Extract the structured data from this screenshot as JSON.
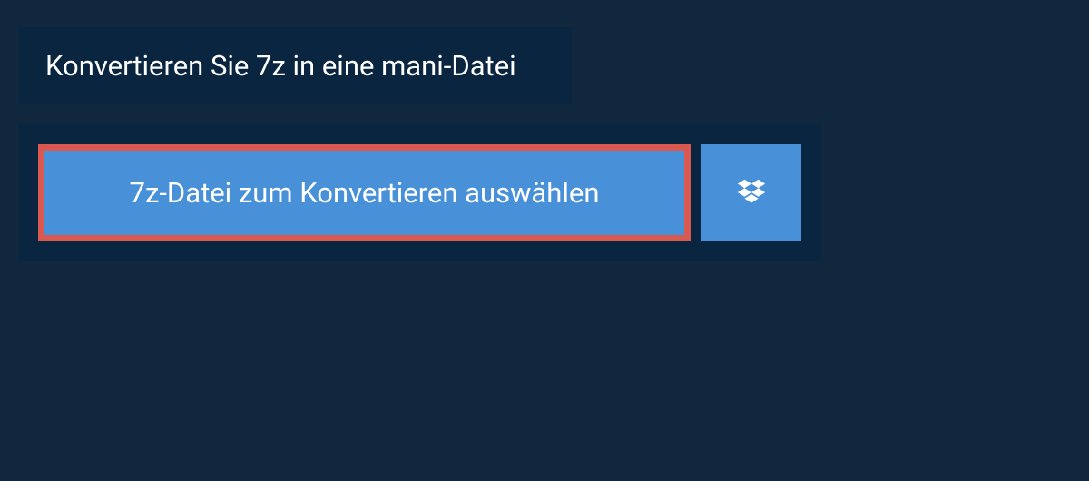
{
  "header": {
    "title": "Konvertieren Sie 7z in eine mani-Datei"
  },
  "upload": {
    "select_file_label": "7z-Datei zum Konvertieren auswählen"
  }
}
